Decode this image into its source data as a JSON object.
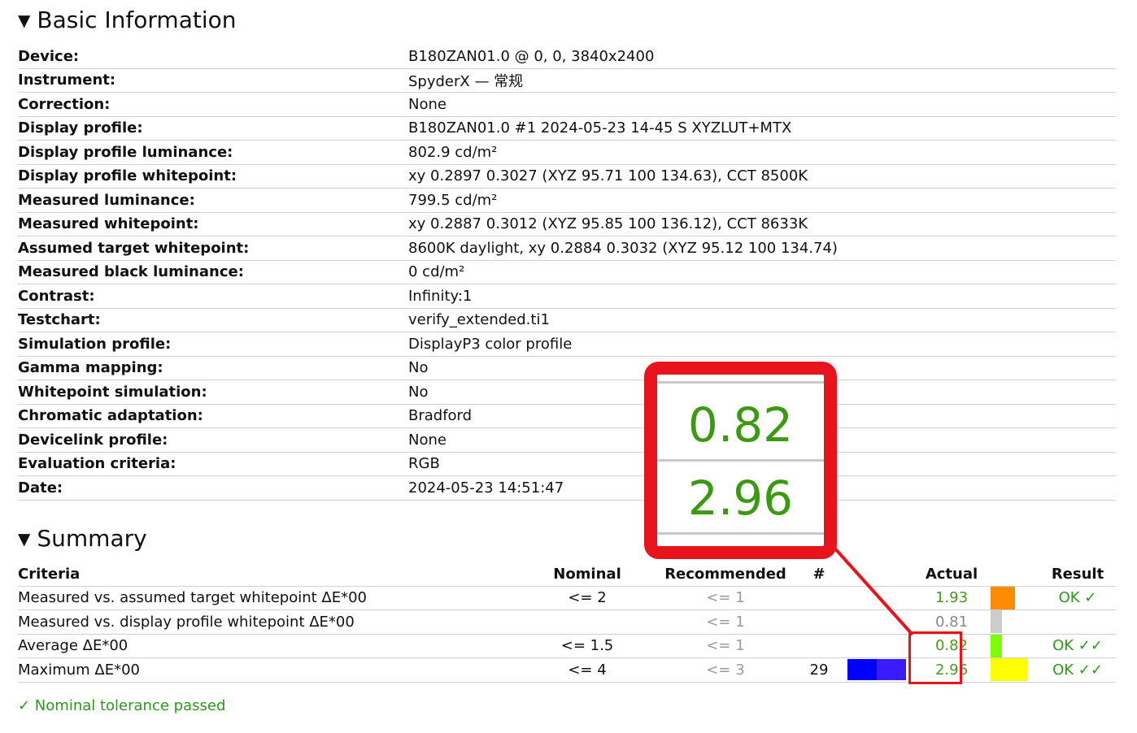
{
  "basic": {
    "title": "Basic Information",
    "rows": [
      {
        "label": "Device:",
        "value": "B180ZAN01.0 @ 0, 0, 3840x2400"
      },
      {
        "label": "Instrument:",
        "value": "SpyderX — 常规"
      },
      {
        "label": "Correction:",
        "value": "None"
      },
      {
        "label": "Display profile:",
        "value": "B180ZAN01.0 #1 2024-05-23 14-45 S XYZLUT+MTX"
      },
      {
        "label": "Display profile luminance:",
        "value": "802.9 cd/m²"
      },
      {
        "label": "Display profile whitepoint:",
        "value": "xy 0.2897 0.3027 (XYZ 95.71 100 134.63), CCT 8500K"
      },
      {
        "label": "Measured luminance:",
        "value": "799.5 cd/m²"
      },
      {
        "label": "Measured whitepoint:",
        "value": "xy 0.2887 0.3012 (XYZ 95.85 100 136.12), CCT 8633K"
      },
      {
        "label": "Assumed target whitepoint:",
        "value": "8600K daylight, xy 0.2884 0.3032 (XYZ 95.12 100 134.74)"
      },
      {
        "label": "Measured black luminance:",
        "value": "0 cd/m²"
      },
      {
        "label": "Contrast:",
        "value": "Infinity:1"
      },
      {
        "label": "Testchart:",
        "value": "verify_extended.ti1"
      },
      {
        "label": "Simulation profile:",
        "value": "DisplayP3 color profile"
      },
      {
        "label": "Gamma mapping:",
        "value": "No"
      },
      {
        "label": "Whitepoint simulation:",
        "value": "No"
      },
      {
        "label": "Chromatic adaptation:",
        "value": "Bradford"
      },
      {
        "label": "Devicelink profile:",
        "value": "None"
      },
      {
        "label": "Evaluation criteria:",
        "value": "RGB"
      },
      {
        "label": "Date:",
        "value": "2024-05-23 14:51:47"
      }
    ]
  },
  "summary": {
    "title": "Summary",
    "headers": {
      "criteria": "Criteria",
      "nominal": "Nominal",
      "recommended": "Recommended",
      "num": "#",
      "actual": "Actual",
      "result": "Result"
    },
    "rows": [
      {
        "criteria": "Measured vs. assumed target whitepoint ΔE*00",
        "nominal": "<= 2",
        "recommended": "<= 1",
        "num": "",
        "actual": "1.93",
        "bar_color": "#ff8c00",
        "result": "OK ✓"
      },
      {
        "criteria": "Measured vs. display profile whitepoint ΔE*00",
        "nominal": "",
        "recommended": "<= 1",
        "num": "",
        "actual": "0.81",
        "bar_color": "#cccccc",
        "result": ""
      },
      {
        "criteria": "Average ΔE*00",
        "nominal": "<= 1.5",
        "recommended": "<= 1",
        "num": "",
        "actual": "0.82",
        "bar_color": "#7cff00",
        "result": "OK ✓✓"
      },
      {
        "criteria": "Maximum ΔE*00",
        "nominal": "<= 4",
        "recommended": "<= 3",
        "num": "29",
        "actual": "2.96",
        "bar_color": "#ffff00",
        "result": "OK ✓✓"
      }
    ],
    "swatch_colors": [
      "#0000ff",
      "#3a1aff"
    ],
    "passed": "✓ Nominal tolerance passed"
  },
  "callout": {
    "values": [
      "0.82",
      "2.96"
    ],
    "border_color": "#e8141b",
    "text_color": "#3b9a12"
  }
}
